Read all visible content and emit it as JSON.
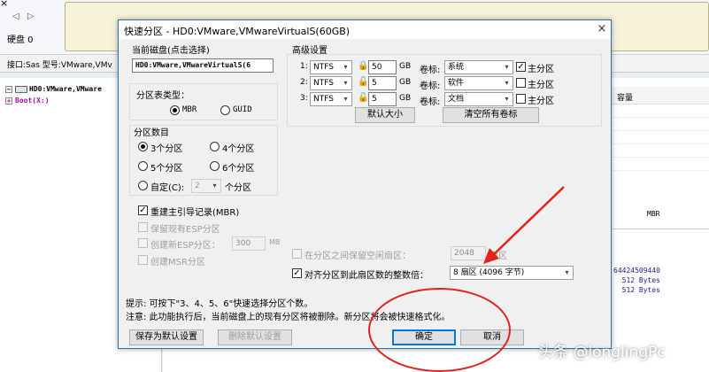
{
  "background": {
    "close_glyph": "×",
    "nav_arrows": "◁ ▷",
    "disk_label": "硬盘 0",
    "info_bar": "接口:Sas  型号:VMware,VMv",
    "tree": [
      {
        "label": "HD0:VMware,VMware",
        "icon": "disk-icon"
      },
      {
        "label": "Boot(X:)",
        "icon": "partition-icon"
      }
    ],
    "table_header": "容量",
    "mbr_label": "MBR",
    "stats": [
      "64424509440",
      "512 Bytes",
      "512 Bytes"
    ]
  },
  "dialog": {
    "title": "快速分区 - HD0:VMware,VMwareVirtualS(60GB)",
    "close_glyph": "×",
    "current_disk": {
      "label": "当前磁盘(点击选择)",
      "value": "HD0:VMware,VMwareVirtualS(6"
    },
    "partition_table": {
      "label": "分区表类型：",
      "options": [
        {
          "label": "MBR",
          "selected": true
        },
        {
          "label": "GUID",
          "selected": false
        }
      ]
    },
    "partition_count": {
      "label": "分区数目",
      "options": [
        {
          "label": "3个分区",
          "selected": true
        },
        {
          "label": "4个分区",
          "selected": false
        },
        {
          "label": "5个分区",
          "selected": false
        },
        {
          "label": "6个分区",
          "selected": false
        }
      ],
      "custom": {
        "label": "自定(C):",
        "value": "2",
        "suffix": "个分区",
        "selected": false
      }
    },
    "options": {
      "rebuild_mbr": {
        "label": "重建主引导记录(MBR)",
        "checked": true
      },
      "keep_esp": {
        "label": "保留现有ESP分区",
        "checked": false
      },
      "create_esp": {
        "label": "创建新ESP分区：",
        "value": "300",
        "unit": "MB",
        "checked": false
      },
      "create_msr": {
        "label": "创建MSR分区",
        "checked": false
      }
    },
    "advanced": {
      "label": "高级设置",
      "rows": [
        {
          "index": "1:",
          "fs": "NTFS",
          "size": "50",
          "unit": "GB",
          "label_prefix": "卷标:",
          "volume": "系统",
          "primary_label": "主分区",
          "primary": true
        },
        {
          "index": "2:",
          "fs": "NTFS",
          "size": "5",
          "unit": "GB",
          "label_prefix": "卷标:",
          "volume": "软件",
          "primary_label": "主分区",
          "primary": false
        },
        {
          "index": "3:",
          "fs": "NTFS",
          "size": "5",
          "unit": "GB",
          "label_prefix": "卷标:",
          "volume": "文档",
          "primary_label": "主分区",
          "primary": false
        }
      ],
      "default_size_button": "默认大小",
      "clear_labels_button": "清空所有卷标"
    },
    "reserve_sectors": {
      "label": "在分区之间保留空闲扇区：",
      "value": "2048",
      "suffix": "扇区",
      "checked": false
    },
    "align_sectors": {
      "label": "对齐分区到此扇区数的整数倍：",
      "value": "8 扇区 (4096 字节)",
      "checked": true
    },
    "hint": "提示: 可按下\"3、4、5、6\"快速选择分区个数。",
    "warning": "注意: 此功能执行后，当前磁盘上的现有分区将被删除。新分区将会被快速格式化。",
    "save_default_button": "保存为默认设置",
    "delete_default_button": "删除默认设置",
    "ok_button": "确定",
    "cancel_button": "取消"
  },
  "annotation_colors": {
    "highlight": "#e2231a"
  },
  "watermark": "头条 @longlingPc"
}
